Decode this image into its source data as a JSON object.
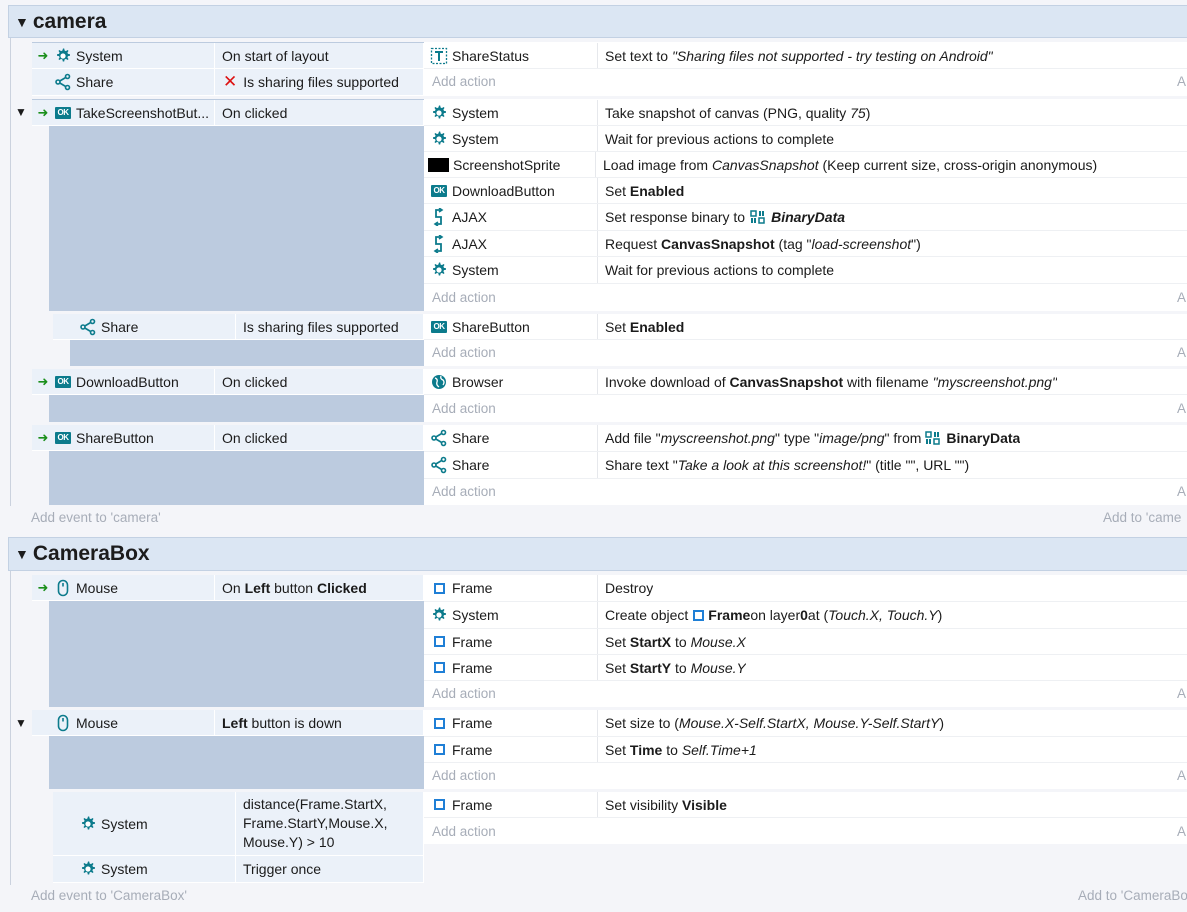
{
  "groups": {
    "camera": {
      "title": "camera",
      "add_event": "Add event to 'camera'",
      "add_to": "Add to 'came"
    },
    "camerabox": {
      "title": "CameraBox",
      "add_event": "Add event to 'CameraBox'",
      "add_to": "Add to 'CameraBo"
    }
  },
  "add_action": "Add action",
  "add_action_right": "A",
  "e1": {
    "c1_obj": "System",
    "c1_text": "On start of layout",
    "c2_obj": "Share",
    "c2_text": "Is sharing files supported",
    "a1_obj": "ShareStatus",
    "a1_pre": "Set text to ",
    "a1_it": "\"Sharing files not supported - try testing on Android\""
  },
  "e2": {
    "c1_obj": "TakeScreenshotBut...",
    "c1_text": "On clicked",
    "a1_obj": "System",
    "a1_pre": "Take snapshot of canvas (PNG, quality ",
    "a1_it": "75",
    "a1_post": ")",
    "a2_obj": "System",
    "a2_text": "Wait for previous actions to complete",
    "a3_obj": "ScreenshotSprite",
    "a3_pre": "Load image from ",
    "a3_it": "CanvasSnapshot",
    "a3_post": " (Keep current size, cross-origin anonymous)",
    "a4_obj": "DownloadButton",
    "a4_pre": "Set ",
    "a4_b": "Enabled",
    "a5_obj": "AJAX",
    "a5_pre": "Set response binary to ",
    "a5_bi": "BinaryData",
    "a6_obj": "AJAX",
    "a6_pre": "Request ",
    "a6_b": "CanvasSnapshot",
    "a6_mid": " (tag \"",
    "a6_it": "load-screenshot",
    "a6_post": "\")",
    "a7_obj": "System",
    "a7_text": "Wait for previous actions to complete"
  },
  "e2s": {
    "c1_obj": "Share",
    "c1_text": "Is sharing files supported",
    "a1_obj": "ShareButton",
    "a1_pre": "Set ",
    "a1_b": "Enabled"
  },
  "e3": {
    "c1_obj": "DownloadButton",
    "c1_text": "On clicked",
    "a1_obj": "Browser",
    "a1_pre": "Invoke download of ",
    "a1_b": "CanvasSnapshot",
    "a1_mid": " with filename ",
    "a1_it": "\"myscreenshot.png\""
  },
  "e4": {
    "c1_obj": "ShareButton",
    "c1_text": "On clicked",
    "a1_obj": "Share",
    "a1_pre": "Add file \"",
    "a1_it1": "myscreenshot.png",
    "a1_mid": "\" type \"",
    "a1_it2": "image/png",
    "a1_mid2": "\" from ",
    "a1_b": "BinaryData",
    "a2_obj": "Share",
    "a2_pre": "Share text \"",
    "a2_it": "Take a look at this screenshot!",
    "a2_post": "\" (title \"\", URL \"\")"
  },
  "e5": {
    "c1_obj": "Mouse",
    "c1_pre": "On ",
    "c1_b1": "Left",
    "c1_mid": " button ",
    "c1_b2": "Clicked",
    "a1_obj": "Frame",
    "a1_text": "Destroy",
    "a2_obj": "System",
    "a2_pre": "Create object ",
    "a2_b1": "Frame",
    "a2_mid": " on layer ",
    "a2_b2": "0",
    "a2_mid2": " at (",
    "a2_it": "Touch.X, Touch.Y",
    "a2_post": ")",
    "a3_obj": "Frame",
    "a3_pre": "Set ",
    "a3_b": "StartX",
    "a3_mid": " to ",
    "a3_it": "Mouse.X",
    "a4_obj": "Frame",
    "a4_pre": "Set ",
    "a4_b": "StartY",
    "a4_mid": " to ",
    "a4_it": "Mouse.Y"
  },
  "e6": {
    "c1_obj": "Mouse",
    "c1_b": "Left",
    "c1_post": " button is down",
    "a1_obj": "Frame",
    "a1_pre": "Set size to (",
    "a1_it": "Mouse.X-Self.StartX, Mouse.Y-Self.StartY",
    "a1_post": ")",
    "a2_obj": "Frame",
    "a2_pre": "Set ",
    "a2_b": "Time",
    "a2_mid": " to ",
    "a2_it": "Self.Time+1"
  },
  "e6s": {
    "c1_obj": "System",
    "c1_l1": "distance(Frame.StartX,",
    "c1_l2": "Frame.StartY,Mouse.X,",
    "c1_l3": "Mouse.Y) > 10",
    "c2_obj": "System",
    "c2_text": "Trigger once",
    "a1_obj": "Frame",
    "a1_pre": "Set visibility ",
    "a1_b": "Visible"
  },
  "icons": {
    "system": "gear-icon",
    "share": "share-icon",
    "button": "button-icon",
    "text": "text-icon",
    "sprite": "sprite-icon",
    "ajax": "ajax-icon",
    "browser": "globe-icon",
    "mouse": "mouse-icon",
    "frame": "frame-icon",
    "binary": "binary-data-icon",
    "not": "invert-x-icon",
    "trigger": "trigger-arrow-icon"
  },
  "colors": {
    "accent": "#0c7b8c",
    "trigger": "#1a8f1a",
    "invert": "#d11111",
    "frame": "#1f7fd6"
  }
}
